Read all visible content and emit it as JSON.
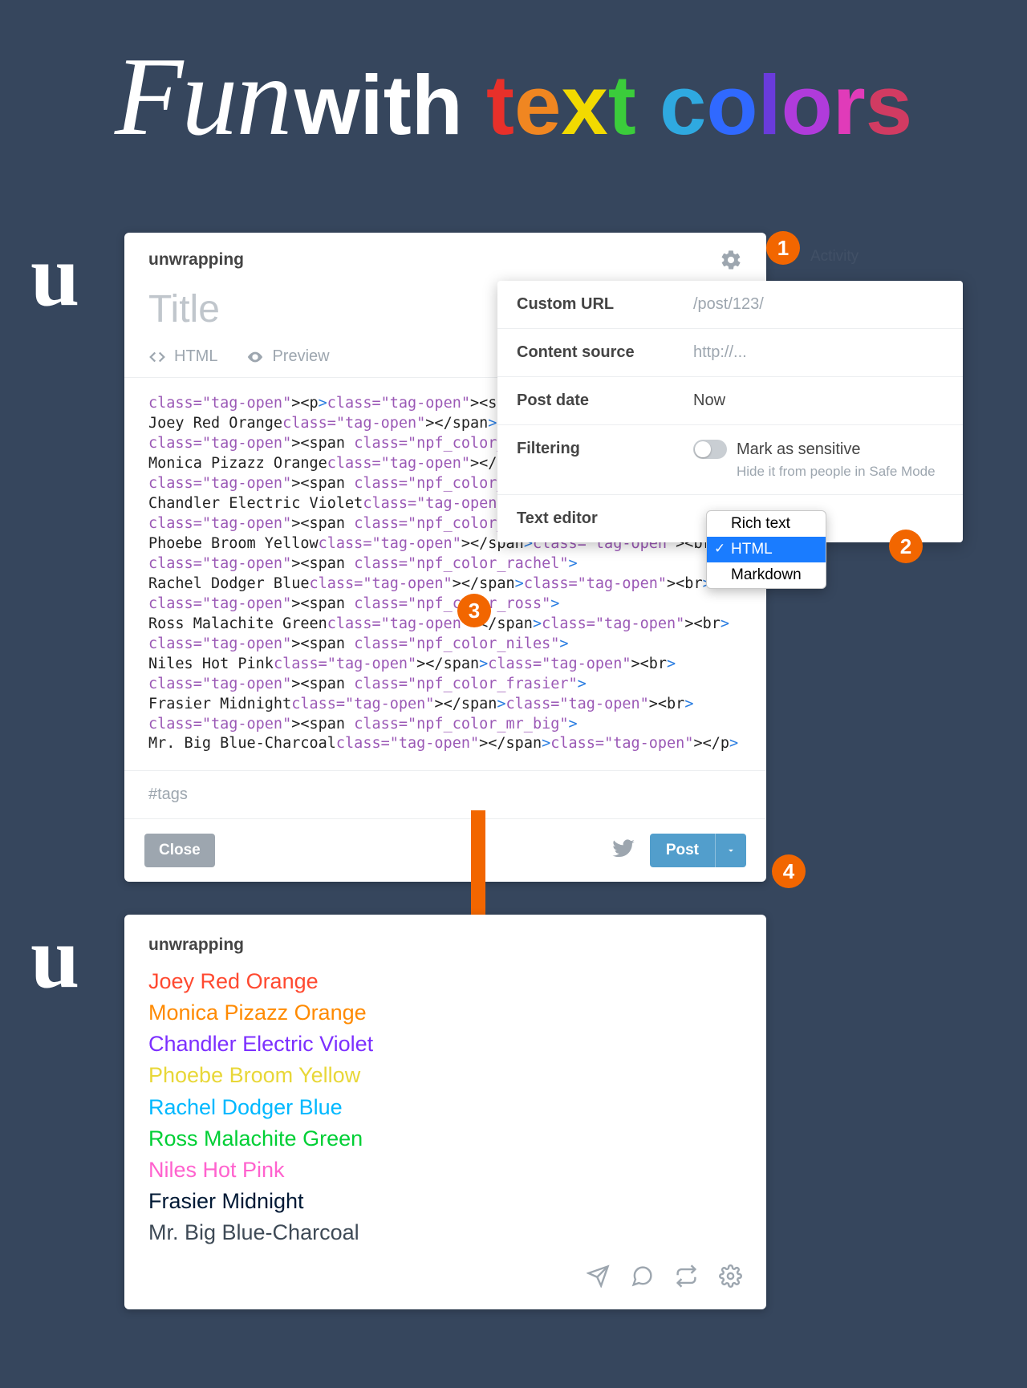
{
  "header": {
    "script": "Fun",
    "plain": " with ",
    "colored": [
      {
        "t": "t",
        "c": "#e8302a"
      },
      {
        "t": "e",
        "c": "#f08621"
      },
      {
        "t": "x",
        "c": "#f2da00"
      },
      {
        "t": "t",
        "c": "#3bcc3b"
      },
      {
        "t": " ",
        "c": "#fff"
      },
      {
        "t": "c",
        "c": "#2fa9e0"
      },
      {
        "t": "o",
        "c": "#3069ff"
      },
      {
        "t": "l",
        "c": "#6a3bdb"
      },
      {
        "t": "o",
        "c": "#b03bdb"
      },
      {
        "t": "r",
        "c": "#e03bb9"
      },
      {
        "t": "s",
        "c": "#d13b62"
      }
    ]
  },
  "avatar_letter": "u",
  "compose": {
    "blog": "unwrapping",
    "title_placeholder": "Title",
    "mode_html": "HTML",
    "mode_preview": "Preview",
    "tags_placeholder": "#tags",
    "close": "Close",
    "post": "Post",
    "code_lines": [
      {
        "open": "<p><span class=\"npf_color_joey\">",
        "text": "",
        "close": ""
      },
      {
        "open": "",
        "text": "Joey Red Orange",
        "close": "</span><br>"
      },
      {
        "open": "<span class=\"npf_color_monica\">",
        "text": "",
        "close": ""
      },
      {
        "open": "",
        "text": "Monica Pizazz Orange",
        "close": "</span><br>"
      },
      {
        "open": "<span class=\"npf_color_chandler\">",
        "text": "",
        "close": ""
      },
      {
        "open": "",
        "text": "Chandler Electric Violet",
        "close": "</span><br>"
      },
      {
        "open": "<span class=\"npf_color_phoebe\">",
        "text": "",
        "close": ""
      },
      {
        "open": "",
        "text": "Phoebe Broom Yellow",
        "close": "</span><br>"
      },
      {
        "open": "<span class=\"npf_color_rachel\">",
        "text": "",
        "close": ""
      },
      {
        "open": "",
        "text": "Rachel Dodger Blue",
        "close": "</span><br>"
      },
      {
        "open": "<span class=\"npf_color_ross\">",
        "text": "",
        "close": ""
      },
      {
        "open": "",
        "text": "Ross Malachite Green",
        "close": "</span><br>"
      },
      {
        "open": "<span class=\"npf_color_niles\">",
        "text": "",
        "close": ""
      },
      {
        "open": "",
        "text": "Niles Hot Pink",
        "close": "</span><br>"
      },
      {
        "open": "<span class=\"npf_color_frasier\">",
        "text": "",
        "close": ""
      },
      {
        "open": "",
        "text": "Frasier Midnight",
        "close": "</span><br>"
      },
      {
        "open": "<span class=\"npf_color_mr_big\">",
        "text": "",
        "close": ""
      },
      {
        "open": "",
        "text": "Mr. Big Blue-Charcoal",
        "close": "</span></p>"
      }
    ]
  },
  "settings": {
    "custom_url_label": "Custom URL",
    "custom_url_placeholder": "/post/123/",
    "content_source_label": "Content source",
    "content_source_placeholder": "http://...",
    "post_date_label": "Post date",
    "post_date_value": "Now",
    "filtering_label": "Filtering",
    "sensitive_label": "Mark as sensitive",
    "sensitive_sub": "Hide it from people in Safe Mode",
    "text_editor_label": "Text editor",
    "editor_options": [
      "Rich text",
      "HTML",
      "Markdown"
    ],
    "editor_selected": "HTML"
  },
  "badges": [
    "1",
    "2",
    "3",
    "4"
  ],
  "activity_ghost": "Activity",
  "result": {
    "blog": "unwrapping",
    "lines": [
      {
        "text": "Joey Red Orange",
        "color": "#ff4930"
      },
      {
        "text": "Monica Pizazz Orange",
        "color": "#ff8a00"
      },
      {
        "text": "Chandler Electric Violet",
        "color": "#7c2fff"
      },
      {
        "text": "Phoebe Broom Yellow",
        "color": "#e8d738"
      },
      {
        "text": "Rachel Dodger Blue",
        "color": "#00b8ff"
      },
      {
        "text": "Ross Malachite Green",
        "color": "#00cf35"
      },
      {
        "text": "Niles Hot Pink",
        "color": "#ff62ce"
      },
      {
        "text": "Frasier Midnight",
        "color": "#001935"
      },
      {
        "text": "Mr. Big Blue-Charcoal",
        "color": "#3e4a56"
      }
    ]
  }
}
